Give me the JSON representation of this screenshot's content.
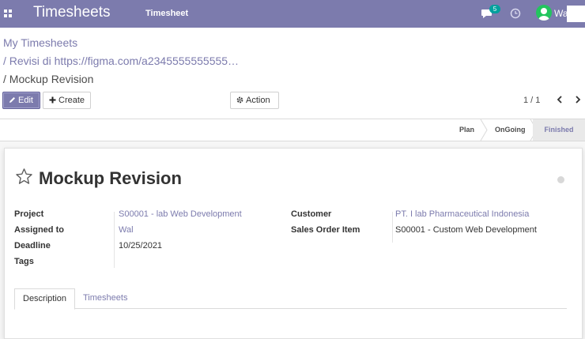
{
  "topbar": {
    "app_title": "Timesheets",
    "menu_item": "Timesheet",
    "chat_badge": "5",
    "user_name": "Wal"
  },
  "breadcrumb": {
    "root": "My Timesheets",
    "parent": "/ Revisi di https://figma.com/a2345555555555…",
    "current": "/ Mockup Revision"
  },
  "toolbar": {
    "edit_label": "Edit",
    "create_label": "Create",
    "action_label": "Action",
    "pager": "1 / 1"
  },
  "stages": {
    "plan": "Plan",
    "ongoing": "OnGoing",
    "finished": "Finished",
    "active": "Finished"
  },
  "record": {
    "title": "Mockup Revision",
    "fields": {
      "project_label": "Project",
      "project_value": "S00001 -      lab Web Development",
      "assigned_label": "Assigned to",
      "assigned_value": "Wal",
      "deadline_label": "Deadline",
      "deadline_value": "10/25/2021",
      "tags_label": "Tags",
      "customer_label": "Customer",
      "customer_value": "PT. I   lab Pharmaceutical Indonesia",
      "sales_label": "Sales Order Item",
      "sales_value": "S00001 - Custom Web Development"
    },
    "tabs": [
      "Description",
      "Timesheets"
    ]
  },
  "colors": {
    "brand": "#7c7bad",
    "badge": "#00a09d",
    "avatar": "#22c55e"
  },
  "icons": [
    "apps-icon",
    "chat-icon",
    "clock-icon",
    "avatar",
    "pencil-icon",
    "plus-icon",
    "gear-icon",
    "chevron-left-icon",
    "chevron-right-icon",
    "star-icon"
  ]
}
